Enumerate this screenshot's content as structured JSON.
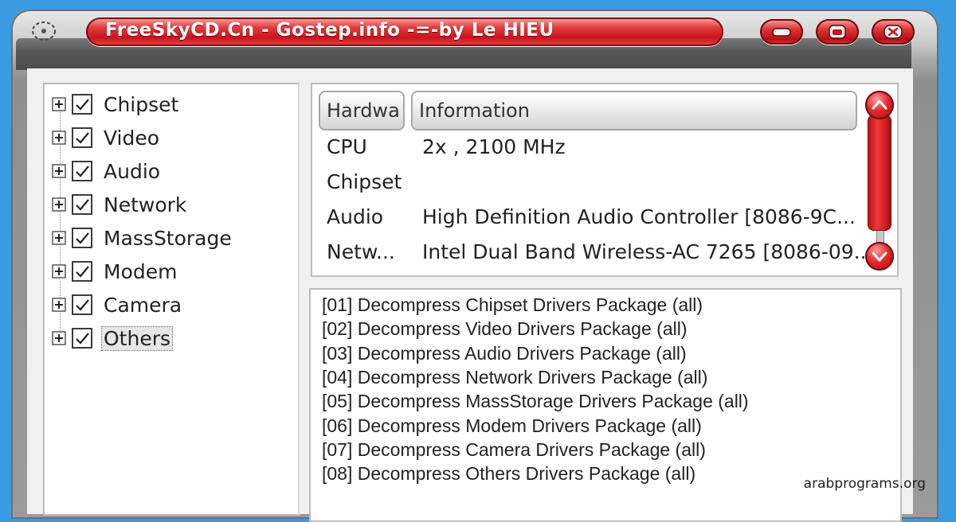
{
  "window": {
    "title": "FreeSkyCD.Cn - Gostep.info -=-by Le HIEU",
    "system_icon": "disc-icon",
    "controls": {
      "minimize_icon": "minimize-icon",
      "maximize_icon": "maximize-icon",
      "close_icon": "close-icon"
    },
    "accent_color": "#d81b22"
  },
  "tree": {
    "items": [
      {
        "label": "Chipset",
        "checked": true
      },
      {
        "label": "Video",
        "checked": true
      },
      {
        "label": "Audio",
        "checked": true
      },
      {
        "label": "Network",
        "checked": true
      },
      {
        "label": "MassStorage",
        "checked": true
      },
      {
        "label": "Modem",
        "checked": true
      },
      {
        "label": "Camera",
        "checked": true
      },
      {
        "label": "Others",
        "checked": true,
        "selected": true
      }
    ]
  },
  "info_table": {
    "headers": [
      "Hardwa",
      "Information"
    ],
    "rows": [
      {
        "hardware": "CPU",
        "information": "2x , 2100 MHz"
      },
      {
        "hardware": "Chipset",
        "information": ""
      },
      {
        "hardware": "Audio",
        "information": "High Definition Audio Controller [8086-9C..."
      },
      {
        "hardware": "Netw...",
        "information": "Intel Dual Band Wireless-AC 7265 [8086-09..."
      }
    ]
  },
  "log": {
    "lines": [
      "[01] Decompress Chipset Drivers Package (all)",
      "[02] Decompress Video Drivers Package (all)",
      "[03] Decompress Audio Drivers Package (all)",
      "[04] Decompress Network Drivers Package (all)",
      "[05] Decompress MassStorage Drivers Package (all)",
      "[06] Decompress Modem Drivers Package (all)",
      "[07] Decompress Camera Drivers Package (all)",
      "[08] Decompress Others Drivers Package (all)"
    ]
  },
  "watermark": "arabprograms.org"
}
